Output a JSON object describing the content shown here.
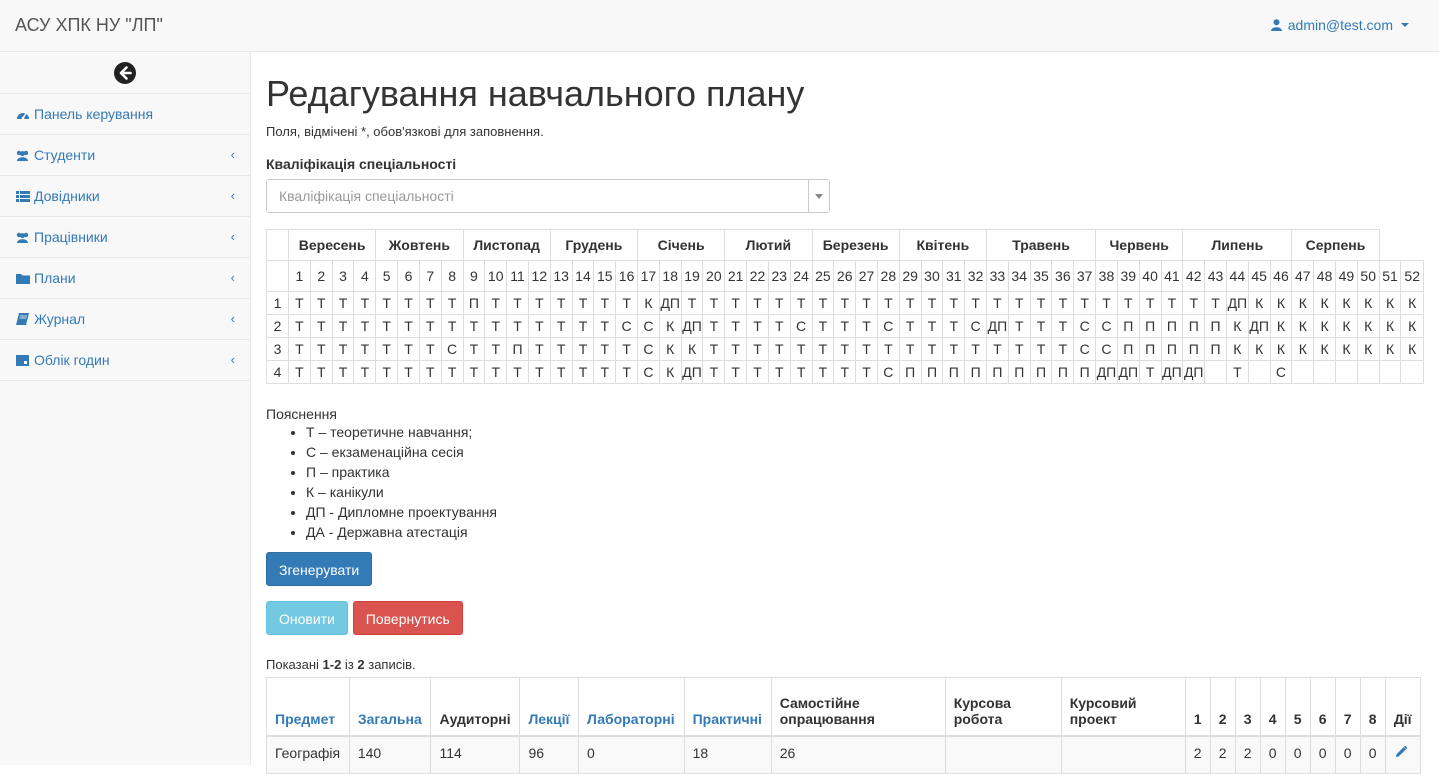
{
  "app": {
    "brand": "АСУ ХПК НУ \"ЛП\"",
    "user": "admin@test.com"
  },
  "sidebar": {
    "items": [
      {
        "label": "Панель керування",
        "icon": "dashboard-icon",
        "chevron": false
      },
      {
        "label": "Студенти",
        "icon": "users-icon",
        "chevron": true
      },
      {
        "label": "Довідники",
        "icon": "list-icon",
        "chevron": true
      },
      {
        "label": "Працівники",
        "icon": "users-icon",
        "chevron": true
      },
      {
        "label": "Плани",
        "icon": "folder-icon",
        "chevron": true
      },
      {
        "label": "Журнал",
        "icon": "book-icon",
        "chevron": true
      },
      {
        "label": "Облік годин",
        "icon": "calendar-icon",
        "chevron": true
      }
    ]
  },
  "page": {
    "title": "Редагування навчального плану",
    "required_note": "Поля, відмічені *, обов'язкові для заповнення.",
    "field_label": "Кваліфікація спеціальності",
    "field_placeholder": "Кваліфікація спеціальності"
  },
  "schedule": {
    "months": [
      {
        "name": "Вересень",
        "span": 4
      },
      {
        "name": "Жовтень",
        "span": 4
      },
      {
        "name": "Листопад",
        "span": 4
      },
      {
        "name": "Грудень",
        "span": 4
      },
      {
        "name": "Січень",
        "span": 4
      },
      {
        "name": "Лютий",
        "span": 4
      },
      {
        "name": "Березень",
        "span": 4
      },
      {
        "name": "Квітень",
        "span": 4
      },
      {
        "name": "Травень",
        "span": 5
      },
      {
        "name": "Червень",
        "span": 4
      },
      {
        "name": "Липень",
        "span": 5
      },
      {
        "name": "Серпень",
        "span": 4
      }
    ],
    "rows": [
      {
        "course": "1",
        "cells": [
          "Т",
          "Т",
          "Т",
          "Т",
          "Т",
          "Т",
          "Т",
          "Т",
          "П",
          "Т",
          "Т",
          "Т",
          "Т",
          "Т",
          "Т",
          "Т",
          "К",
          "ДП",
          "Т",
          "Т",
          "Т",
          "Т",
          "Т",
          "Т",
          "Т",
          "Т",
          "Т",
          "Т",
          "Т",
          "Т",
          "Т",
          "Т",
          "Т",
          "Т",
          "Т",
          "Т",
          "Т",
          "Т",
          "Т",
          "Т",
          "Т",
          "Т",
          "Т",
          "ДП",
          "К",
          "К",
          "К",
          "К",
          "К",
          "К",
          "К",
          "К"
        ]
      },
      {
        "course": "2",
        "cells": [
          "Т",
          "Т",
          "Т",
          "Т",
          "Т",
          "Т",
          "Т",
          "Т",
          "Т",
          "Т",
          "Т",
          "Т",
          "Т",
          "Т",
          "Т",
          "С",
          "С",
          "К",
          "ДП",
          "Т",
          "Т",
          "Т",
          "Т",
          "С",
          "Т",
          "Т",
          "Т",
          "С",
          "Т",
          "Т",
          "Т",
          "С",
          "ДП",
          "Т",
          "Т",
          "Т",
          "С",
          "С",
          "П",
          "П",
          "П",
          "П",
          "П",
          "К",
          "ДП",
          "К",
          "К",
          "К",
          "К",
          "К",
          "К",
          "К"
        ]
      },
      {
        "course": "3",
        "cells": [
          "Т",
          "Т",
          "Т",
          "Т",
          "Т",
          "Т",
          "Т",
          "С",
          "Т",
          "Т",
          "П",
          "Т",
          "Т",
          "Т",
          "Т",
          "Т",
          "С",
          "К",
          "К",
          "Т",
          "Т",
          "Т",
          "Т",
          "Т",
          "Т",
          "Т",
          "Т",
          "Т",
          "Т",
          "Т",
          "Т",
          "Т",
          "Т",
          "Т",
          "Т",
          "Т",
          "С",
          "С",
          "П",
          "П",
          "П",
          "П",
          "П",
          "К",
          "К",
          "К",
          "К",
          "К",
          "К",
          "К",
          "К",
          "К"
        ]
      },
      {
        "course": "4",
        "cells": [
          "Т",
          "Т",
          "Т",
          "Т",
          "Т",
          "Т",
          "Т",
          "Т",
          "Т",
          "Т",
          "Т",
          "Т",
          "Т",
          "Т",
          "Т",
          "Т",
          "С",
          "К",
          "ДП",
          "Т",
          "Т",
          "Т",
          "Т",
          "Т",
          "Т",
          "Т",
          "Т",
          "С",
          "П",
          "П",
          "П",
          "П",
          "П",
          "П",
          "П",
          "П",
          "П",
          "ДП",
          "ДП",
          "Т",
          "ДП",
          "ДП",
          "",
          "Т",
          "",
          "С",
          "",
          "",
          "",
          "",
          "",
          ""
        ]
      }
    ]
  },
  "legend": {
    "title": "Пояснення",
    "items": [
      "Т – теоретичне навчання;",
      "С – екзаменаційна сесія",
      "П – практика",
      "К – канікули",
      "ДП - Дипломне проектування",
      "ДА - Державна атестація"
    ]
  },
  "buttons": {
    "generate": "Згенерувати",
    "update": "Оновити",
    "back": "Повернутись"
  },
  "summary": {
    "prefix": "Показані ",
    "range": "1-2",
    "middle": " із ",
    "total": "2",
    "suffix": " записів."
  },
  "table": {
    "headers": [
      {
        "label": "Предмет",
        "link": true
      },
      {
        "label": "Загальна",
        "link": true
      },
      {
        "label": "Аудиторні",
        "link": false
      },
      {
        "label": "Лекції",
        "link": true
      },
      {
        "label": "Лабораторні",
        "link": true
      },
      {
        "label": "Практичні",
        "link": true
      },
      {
        "label": "Самостійне опрацювання",
        "link": false
      },
      {
        "label": "Курсова робота",
        "link": false
      },
      {
        "label": "Курсовий проект",
        "link": false
      },
      {
        "label": "1",
        "link": false
      },
      {
        "label": "2",
        "link": false
      },
      {
        "label": "3",
        "link": false
      },
      {
        "label": "4",
        "link": false
      },
      {
        "label": "5",
        "link": false
      },
      {
        "label": "6",
        "link": false
      },
      {
        "label": "7",
        "link": false
      },
      {
        "label": "8",
        "link": false
      },
      {
        "label": "Дії",
        "link": false
      }
    ],
    "rows": [
      [
        "Географія",
        "140",
        "114",
        "96",
        "0",
        "18",
        "26",
        "",
        "",
        "2",
        "2",
        "2",
        "0",
        "0",
        "0",
        "0",
        "0"
      ]
    ]
  },
  "colors": {
    "link": "#337ab7",
    "primary": "#337ab7",
    "info": "#5bc0de",
    "danger": "#d9534f"
  }
}
